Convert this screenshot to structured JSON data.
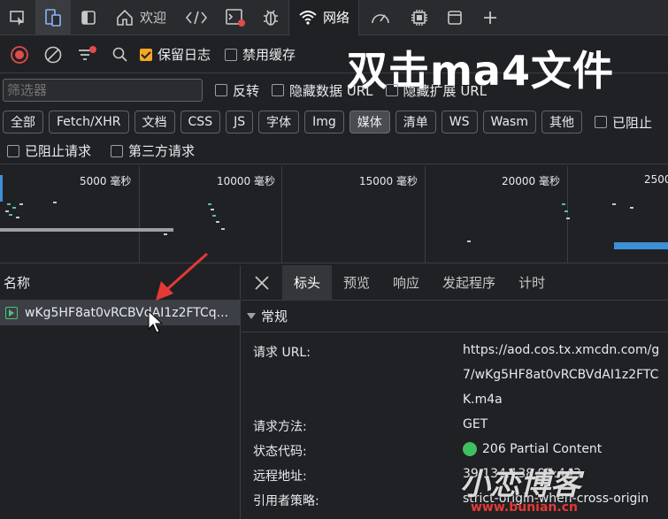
{
  "overlay_title": "双击ma4文件",
  "tabs": [
    {
      "label": "欢迎"
    },
    {
      "label": "网络"
    }
  ],
  "toolbar": {
    "preserve_log_label": "保留日志",
    "disable_cache_label": "禁用缓存"
  },
  "filter": {
    "placeholder": "筛选器",
    "invert_label": "反转",
    "hide_data_url_label": "隐藏数据 URL",
    "hide_ext_url_label": "隐藏扩展 URL"
  },
  "chips": [
    "全部",
    "Fetch/XHR",
    "文档",
    "CSS",
    "JS",
    "字体",
    "Img",
    "媒体",
    "清单",
    "WS",
    "Wasm",
    "其他"
  ],
  "blocked_cookie_label": "已阻止",
  "row3": {
    "blocked_requests_label": "已阻止请求",
    "third_party_label": "第三方请求"
  },
  "overview": {
    "ticks": [
      "5000 毫秒",
      "10000 毫秒",
      "15000 毫秒",
      "20000 毫秒",
      "2500"
    ]
  },
  "name_column": {
    "header": "名称",
    "request_name": "wKg5HF8at0vRCBVdAI1z2FTCq..."
  },
  "detail": {
    "tabs": [
      "标头",
      "预览",
      "响应",
      "发起程序",
      "计时"
    ],
    "section": "常规",
    "labels": {
      "url": "请求 URL:",
      "method": "请求方法:",
      "status": "状态代码:",
      "remote": "远程地址:",
      "referrer": "引用者策略:"
    },
    "values": {
      "url_line1": "https://aod.cos.tx.xmcdn.com/g",
      "url_line2": "7/wKg5HF8at0vRCBVdAI1z2FTC",
      "url_line3": "K.m4a",
      "method": "GET",
      "status": "206 Partial Content",
      "remote": "39.134.138.97:443",
      "referrer": "strict-origin-when-cross-origin"
    }
  },
  "watermark": {
    "text": "小恋博客",
    "url": "www.bunian.cn"
  },
  "colors": {
    "accent": "#f5a623",
    "record_red": "#e04c4c",
    "status_green": "#3fbf5f",
    "arrow_red": "#e53935"
  }
}
